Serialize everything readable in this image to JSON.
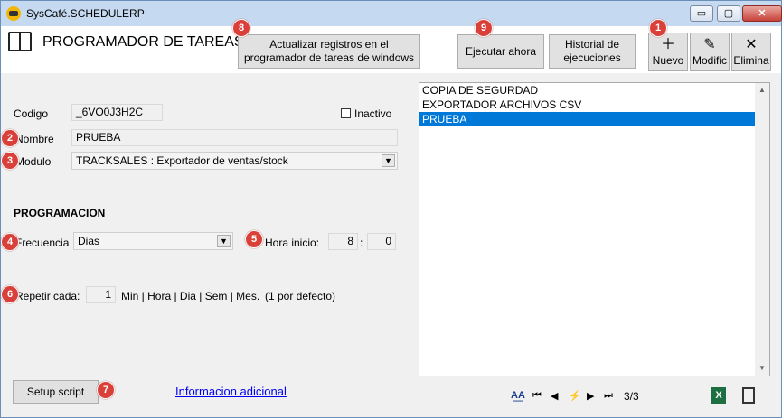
{
  "window": {
    "title": "SysCafé.SCHEDULERP",
    "minimize_glyph": "▭",
    "maximize_glyph": "▢",
    "close_glyph": "✕"
  },
  "header": {
    "page_title": "PROGRAMADOR DE TAREAS",
    "update_button": "Actualizar registros en el programador de tareas de windows",
    "execute_button": "Ejecutar ahora",
    "history_button": "Historial de ejecuciones",
    "new_button": "Nuevo",
    "modify_button": "Modific",
    "delete_button": "Elimina",
    "new_icon": "plus-icon",
    "modify_icon": "pencil-icon",
    "delete_icon": "x-icon"
  },
  "form": {
    "codigo_label": "Codigo",
    "codigo_value": "_6VO0J3H2C",
    "inactivo_label": "Inactivo",
    "nombre_label": "Nombre",
    "nombre_value": "PRUEBA",
    "modulo_label": "Modulo",
    "modulo_value": "TRACKSALES : Exportador de ventas/stock",
    "programacion_heading": "PROGRAMACION",
    "frecuencia_label": "Frecuencia",
    "frecuencia_value": "Dias",
    "hora_inicio_label": "Hora inicio:",
    "hora_value": "8",
    "hora_separator": ":",
    "minuto_value": "0",
    "repetir_label": "Repetir cada:",
    "repetir_value": "1",
    "repetir_units": "Min | Hora | Dia | Sem | Mes.",
    "repetir_hint": "(1 por defecto)"
  },
  "list": {
    "items": [
      "COPIA DE SEGURDAD",
      "EXPORTADOR ARCHIVOS CSV",
      "PRUEBA"
    ],
    "selected_index": 2
  },
  "footer": {
    "setup_button": "Setup script",
    "info_link": "Informacion adicional",
    "record_position": "3/3",
    "excel_icon": "excel-icon",
    "exit_icon": "exit-door-icon"
  },
  "badges": [
    "1",
    "2",
    "3",
    "4",
    "5",
    "6",
    "7",
    "8",
    "9"
  ],
  "colors": {
    "badge": "#d9403a",
    "selection": "#0078d7",
    "link": "#0000ee"
  }
}
